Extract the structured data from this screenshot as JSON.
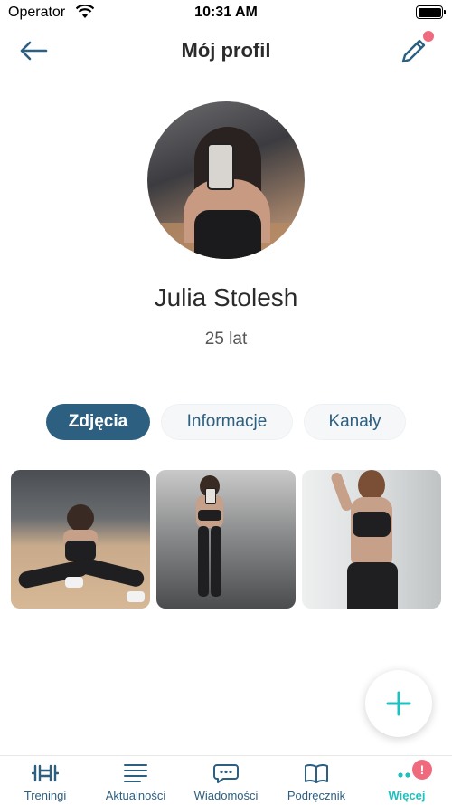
{
  "status_bar": {
    "carrier": "Operator",
    "time": "10:31 AM"
  },
  "header": {
    "title": "Mój profil"
  },
  "profile": {
    "name": "Julia Stolesh",
    "age": "25 lat"
  },
  "tabs": [
    {
      "label": "Zdjęcia",
      "active": true
    },
    {
      "label": "Informacje",
      "active": false
    },
    {
      "label": "Kanały",
      "active": false
    }
  ],
  "bottom_nav": {
    "items": [
      {
        "label": "Treningi",
        "icon": "dumbbell-icon"
      },
      {
        "label": "Aktualności",
        "icon": "news-lines-icon"
      },
      {
        "label": "Wiadomości",
        "icon": "chat-bubble-icon"
      },
      {
        "label": "Podręcznik",
        "icon": "book-icon"
      },
      {
        "label": "Więcej",
        "icon": "more-dots-icon",
        "active": true,
        "badge": "!"
      }
    ]
  },
  "colors": {
    "primary": "#2d5f80",
    "accent": "#20bfc0",
    "alert": "#f06a7e"
  }
}
